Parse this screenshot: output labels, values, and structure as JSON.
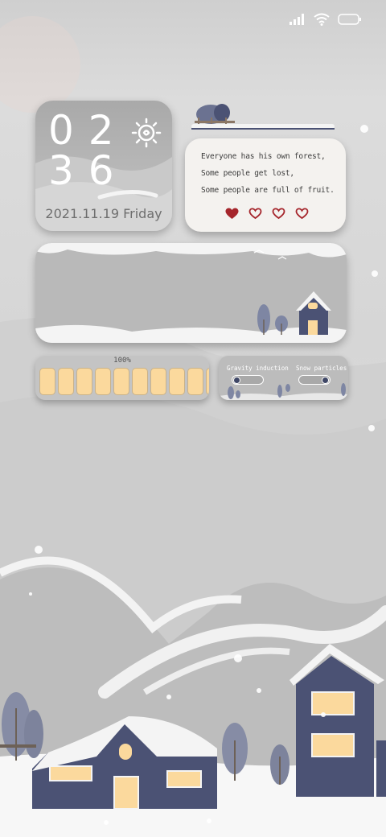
{
  "status_bar": {
    "signal_icon": "signal-icon",
    "wifi_icon": "wifi-icon",
    "battery_icon": "battery-icon"
  },
  "clock_widget": {
    "hour": "02",
    "minute": "36",
    "date": "2021.11.19 Friday",
    "weather_icon": "sun-icon"
  },
  "quote_widget": {
    "lines": [
      "Everyone has his own forest,",
      "Some people get lost,",
      "Some people are full of fruit."
    ],
    "hearts": [
      {
        "filled": true
      },
      {
        "filled": false
      },
      {
        "filled": false
      },
      {
        "filled": false
      }
    ],
    "heart_fill_color": "#a5252b"
  },
  "battery_widget": {
    "label": "100%",
    "level": 1.0,
    "cells": 10,
    "cell_color": "#fbd99d"
  },
  "toggle_widget": {
    "gravity": {
      "label": "Gravity induction",
      "state": "off"
    },
    "snow": {
      "label": "Snow particles",
      "state": "on"
    }
  },
  "colors": {
    "house": "#4b5274",
    "window": "#fbd99d",
    "snow": "#f4f4f4",
    "tree": "#7e86a3"
  }
}
